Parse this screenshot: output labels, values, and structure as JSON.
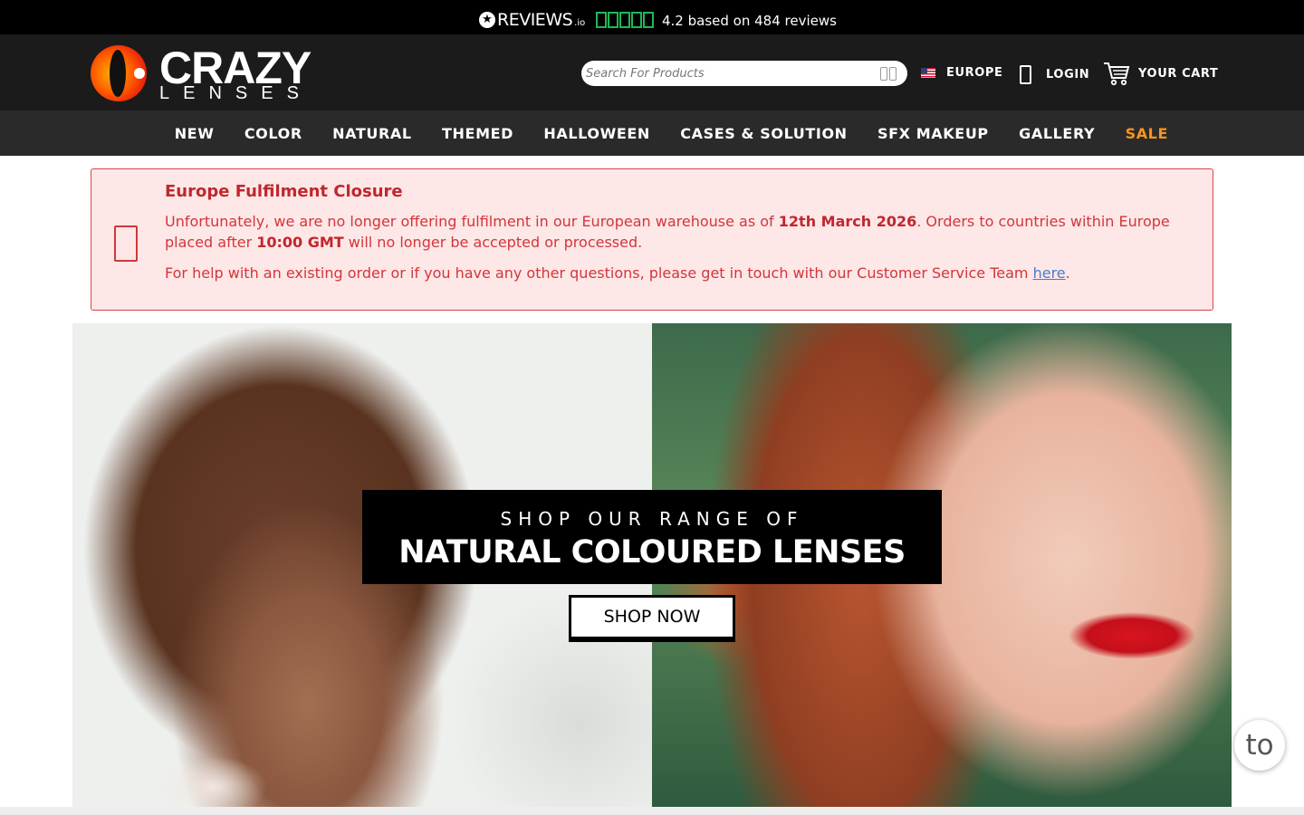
{
  "review_bar": {
    "brand": "REVIEWS",
    "brand_suffix": ".io",
    "rating_text": "4.2 based on 484 reviews",
    "star_color": "#1eb857"
  },
  "header": {
    "logo_main": "CRAZY",
    "logo_sub": "LENSES",
    "search_placeholder": "Search For Products",
    "region_label": "EUROPE",
    "login_label": "LOGIN",
    "cart_label": "YOUR CART"
  },
  "nav": {
    "items": [
      {
        "label": "NEW"
      },
      {
        "label": "COLOR"
      },
      {
        "label": "NATURAL"
      },
      {
        "label": "THEMED"
      },
      {
        "label": "HALLOWEEN"
      },
      {
        "label": "CASES & SOLUTION"
      },
      {
        "label": "SFX MAKEUP"
      },
      {
        "label": "GALLERY"
      },
      {
        "label": "SALE"
      }
    ],
    "sale_color": "#f7941d"
  },
  "alert": {
    "title": "Europe Fulfilment Closure",
    "body_part1": "Unfortunately, we are no longer offering fulfilment in our European warehouse as of ",
    "body_date": "12th March 2026",
    "body_part2": ". Orders to countries within Europe placed after ",
    "body_time": "10:00 GMT",
    "body_part3": " will no longer be accepted or processed.",
    "help_text": "For help with an existing order or if you have any other questions, please get in touch with our Customer Service Team ",
    "help_link": "here",
    "help_end": "."
  },
  "hero": {
    "banner_line1": "SHOP OUR RANGE OF",
    "banner_line2": "NATURAL COLOURED LENSES",
    "button_label": "SHOP NOW"
  },
  "to_top": {
    "label": "to"
  }
}
